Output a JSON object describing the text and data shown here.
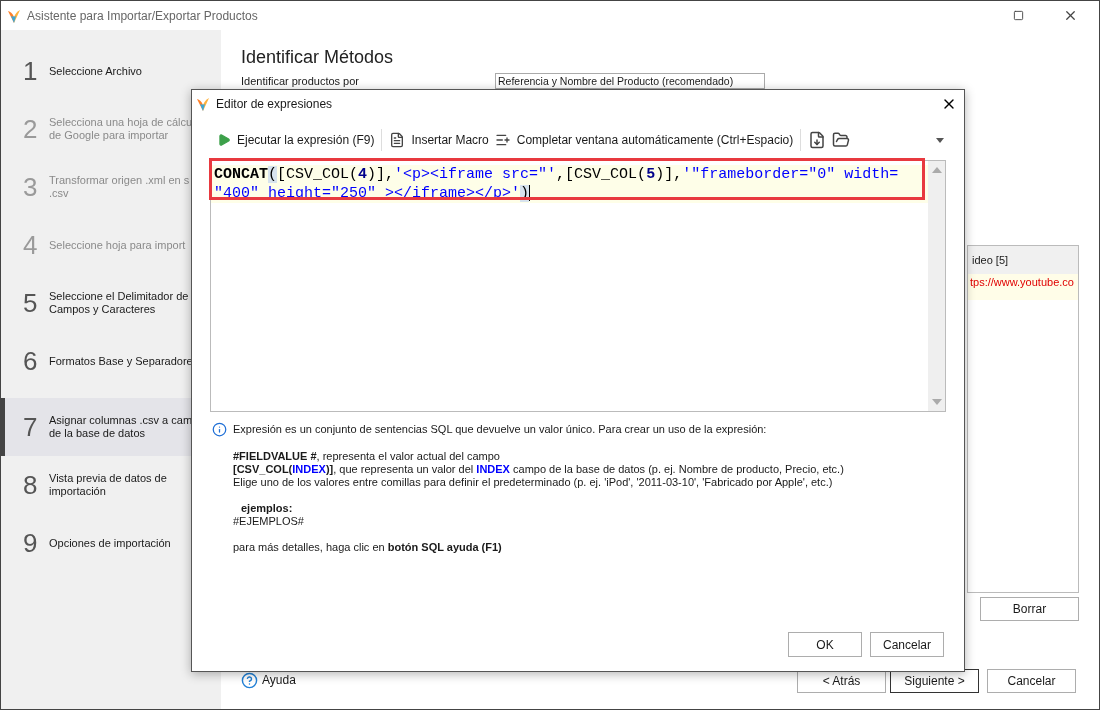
{
  "window": {
    "title": "Asistente para Importar/Exportar Productos"
  },
  "steps": [
    {
      "number": "1",
      "label": "Seleccione Archivo",
      "selected": false,
      "disabled": false
    },
    {
      "number": "2",
      "label": "Selecciona una hoja de cálcu\nde Google para importar",
      "selected": false,
      "disabled": true
    },
    {
      "number": "3",
      "label": "Transformar origen .xml en s\n.csv",
      "selected": false,
      "disabled": true
    },
    {
      "number": "4",
      "label": "Seleccione hoja para import",
      "selected": false,
      "disabled": true
    },
    {
      "number": "5",
      "label": "Seleccione el Delimitador de\nCampos y Caracteres",
      "selected": false,
      "disabled": false
    },
    {
      "number": "6",
      "label": "Formatos Base y Separadore",
      "selected": false,
      "disabled": false
    },
    {
      "number": "7",
      "label": "Asignar columnas .csv a cam\nde la base de datos",
      "selected": true,
      "disabled": false
    },
    {
      "number": "8",
      "label": "Vista previa de datos de\nimportación",
      "selected": false,
      "disabled": false
    },
    {
      "number": "9",
      "label": "Opciones de importación",
      "selected": false,
      "disabled": false
    }
  ],
  "page": {
    "heading": "Identificar Métodos",
    "identify_label": "Identificar productos por",
    "identify_value": "Referencia y Nombre del Producto (recomendado)"
  },
  "grid": {
    "column_header": "ideo [5]",
    "cell": "tps://www.youtube.co"
  },
  "clear_button": "Borrar",
  "help_link": "Ayuda",
  "nav_buttons": [
    {
      "label": "< Atrás",
      "default": false
    },
    {
      "label": "Siguiente >",
      "default": true
    },
    {
      "label": "Cancelar",
      "default": false
    }
  ],
  "dialog": {
    "title": "Editor de expresiones",
    "toolbar": [
      {
        "kind": "run",
        "label": "Ejecutar la expresión (F9)"
      },
      {
        "kind": "separator"
      },
      {
        "kind": "macro",
        "label": "Insertar Macro"
      },
      {
        "kind": "autocomplete",
        "label": "Completar ventana automáticamente (Ctrl+Espacio)"
      },
      {
        "kind": "separator"
      },
      {
        "kind": "export"
      },
      {
        "kind": "open"
      }
    ],
    "code_lines": [
      [
        {
          "kind": "function",
          "text": "CONCAT"
        },
        {
          "kind": "match",
          "text": "("
        },
        {
          "kind": "punct",
          "text": "[CSV_COL("
        },
        {
          "kind": "number",
          "text": "4"
        },
        {
          "kind": "punct",
          "text": ")],"
        },
        {
          "kind": "string",
          "text": "'<p><iframe src=\"'"
        },
        {
          "kind": "punct",
          "text": ",[CSV_COL("
        },
        {
          "kind": "number",
          "text": "5"
        },
        {
          "kind": "punct",
          "text": ")],"
        },
        {
          "kind": "string",
          "text": "'\"frameborder=\"0\" width="
        }
      ],
      [
        {
          "kind": "string",
          "text": "\"400\" height=\"250\" ></iframe></p>'"
        },
        {
          "kind": "match",
          "text": ")"
        }
      ]
    ],
    "help_intro": "Expresión es un conjunto de sentencias SQL que devuelve un valor único. Para crear un uso de la expresión:",
    "help_paragraphs": [
      [
        [
          {
            "kind": "bold",
            "text": "#FIELDVALUE #"
          },
          {
            "kind": "plain",
            "text": ", representa el valor actual del campo"
          }
        ],
        [
          {
            "kind": "bold",
            "text": "[CSV_COL("
          },
          {
            "kind": "keyword",
            "text": "INDEX"
          },
          {
            "kind": "bold",
            "text": ")]"
          },
          {
            "kind": "plain",
            "text": ", que representa un valor del "
          },
          {
            "kind": "keyword",
            "text": "INDEX"
          },
          {
            "kind": "plain",
            "text": " campo de la base de datos (p. ej. Nombre de producto, Precio, etc.)"
          }
        ],
        [
          {
            "kind": "plain",
            "text": "Elige uno de los valores entre comillas para definir el predeterminado (p. ej. 'iPod', '2011-03-10', 'Fabricado por Apple', etc.)"
          }
        ]
      ],
      [
        [
          {
            "kind": "heading",
            "text": "ejemplos:"
          }
        ],
        [
          {
            "kind": "plain",
            "text": "#EJEMPLOS#"
          }
        ]
      ],
      [
        [
          {
            "kind": "plain",
            "text": "para más detalles, haga clic en "
          },
          {
            "kind": "bold",
            "text": "botón SQL ayuda (F1)"
          }
        ]
      ]
    ],
    "buttons": [
      {
        "label": "OK"
      },
      {
        "label": "Cancelar"
      }
    ]
  }
}
